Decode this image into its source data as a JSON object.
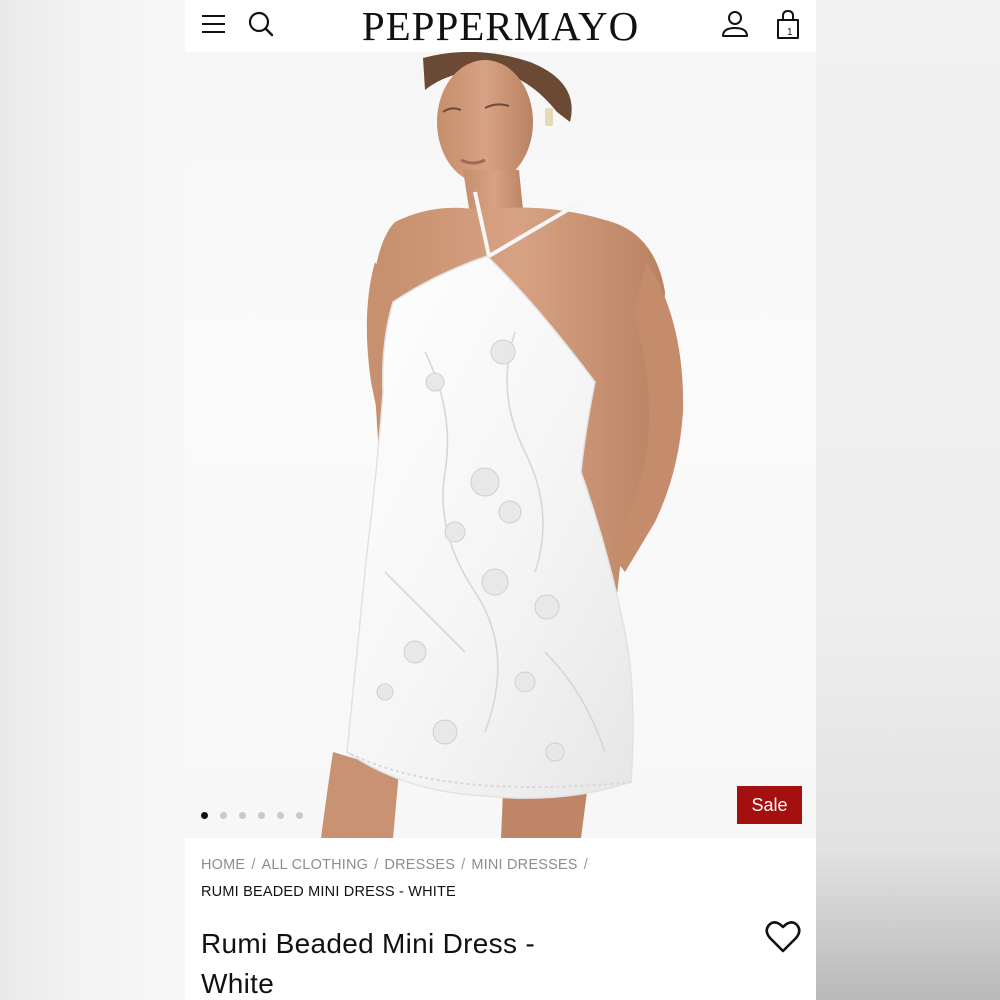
{
  "header": {
    "logo": "PEPPERMAYO",
    "cart_count": "1",
    "icons": [
      "menu-icon",
      "search-icon",
      "account-icon",
      "cart-icon"
    ]
  },
  "gallery": {
    "slide_count": 6,
    "active_slide": 1,
    "sale_badge": "Sale",
    "sale_color": "#a40f0f"
  },
  "breadcrumb": {
    "items": [
      "HOME",
      "ALL CLOTHING",
      "DRESSES",
      "MINI DRESSES"
    ],
    "separator": "/",
    "current": "RUMI BEADED MINI DRESS - WHITE"
  },
  "product": {
    "title_line1": "Rumi Beaded Mini Dress -",
    "title_line2": "White"
  }
}
